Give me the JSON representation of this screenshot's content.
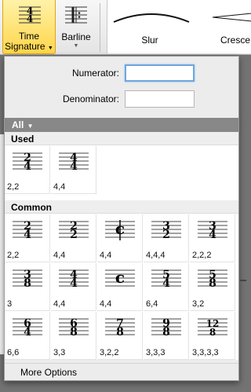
{
  "ribbon": {
    "time_signature_label_1": "Time",
    "time_signature_label_2": "Signature",
    "barline_label": "Barline",
    "gallery_items": [
      {
        "label": "Slur"
      },
      {
        "label": "Cresce"
      }
    ]
  },
  "popup": {
    "numerator_label": "Numerator:",
    "denominator_label": "Denominator:",
    "numerator_value": "",
    "denominator_value": "",
    "filter_label": "All",
    "sections": [
      {
        "title": "Used",
        "items": [
          {
            "top": "2",
            "bottom": "4",
            "kind": "num",
            "label": "2,2"
          },
          {
            "top": "4",
            "bottom": "4",
            "kind": "num",
            "label": "4,4"
          }
        ]
      },
      {
        "title": "Common",
        "items": [
          {
            "top": "2",
            "bottom": "4",
            "kind": "num",
            "label": "2,2"
          },
          {
            "top": "2",
            "bottom": "2",
            "kind": "num",
            "label": "4,4"
          },
          {
            "kind": "cut",
            "label": "4,4"
          },
          {
            "top": "3",
            "bottom": "2",
            "kind": "num",
            "label": "4,4,4"
          },
          {
            "top": "3",
            "bottom": "4",
            "kind": "num",
            "label": "2,2,2"
          },
          {
            "top": "3",
            "bottom": "8",
            "kind": "num",
            "label": "3"
          },
          {
            "top": "4",
            "bottom": "4",
            "kind": "num",
            "label": "4,4"
          },
          {
            "kind": "common",
            "label": "4,4"
          },
          {
            "top": "5",
            "bottom": "4",
            "kind": "num",
            "label": "6,4"
          },
          {
            "top": "5",
            "bottom": "8",
            "kind": "num",
            "label": "3,2"
          },
          {
            "top": "6",
            "bottom": "4",
            "kind": "num",
            "label": "6,6"
          },
          {
            "top": "6",
            "bottom": "8",
            "kind": "num",
            "label": "3,3"
          },
          {
            "top": "7",
            "bottom": "8",
            "kind": "num",
            "label": "3,2,2"
          },
          {
            "top": "9",
            "bottom": "8",
            "kind": "num",
            "label": "3,3,3"
          },
          {
            "top": "12",
            "bottom": "8",
            "kind": "num",
            "label": "3,3,3,3"
          }
        ]
      }
    ],
    "more_options_label": "More Options"
  },
  "colors": {
    "ribbon_active": "#ffd64a",
    "filter_bar": "#888888",
    "focus_ring": "#6fa6df"
  }
}
